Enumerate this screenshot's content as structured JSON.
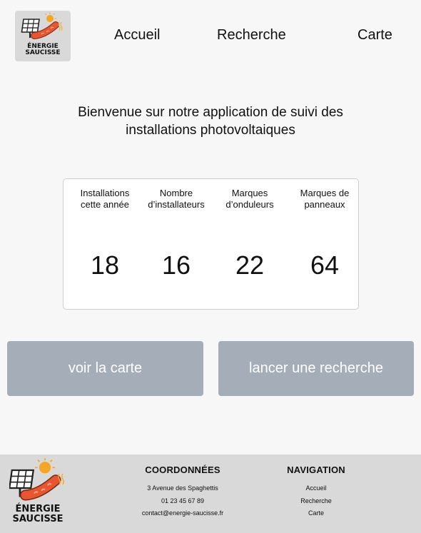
{
  "header": {
    "logo_line1": "ÉNERGIE",
    "logo_line2": "SAUCISSE",
    "nav": [
      {
        "label": "Accueil"
      },
      {
        "label": "Recherche"
      },
      {
        "label": "Carte"
      }
    ]
  },
  "welcome": {
    "line1": "Bienvenue sur notre application de suivi des",
    "line2": "installations photovoltaiques"
  },
  "stats": [
    {
      "label_line1": "Installations",
      "label_line2": "cette année",
      "value": "18"
    },
    {
      "label_line1": "Nombre",
      "label_line2": "d’installateurs",
      "value": "16"
    },
    {
      "label_line1": "Marques",
      "label_line2": "d’onduleurs",
      "value": "22"
    },
    {
      "label_line1": "Marques de",
      "label_line2": "panneaux",
      "value": "64"
    }
  ],
  "buttons": {
    "map": "voir la carte",
    "search": "lancer une recherche"
  },
  "footer": {
    "logo_line1": "ÉNERGIE",
    "logo_line2": "SAUCISSE",
    "contact": {
      "title": "COORDONNÉES",
      "address": "3 Avenue des Spaghettis",
      "phone": "01 23 45 67 89",
      "email": "contact@energie-saucisse.fr"
    },
    "navigation": {
      "title": "NAVIGATION",
      "links": [
        "Accueil",
        "Recherche",
        "Carte"
      ]
    }
  },
  "colors": {
    "background": "#f7f7f7",
    "button": "#a4adb8",
    "footer": "#d9d9d9",
    "sausage": "#e8552f",
    "sun": "#f5a623"
  }
}
